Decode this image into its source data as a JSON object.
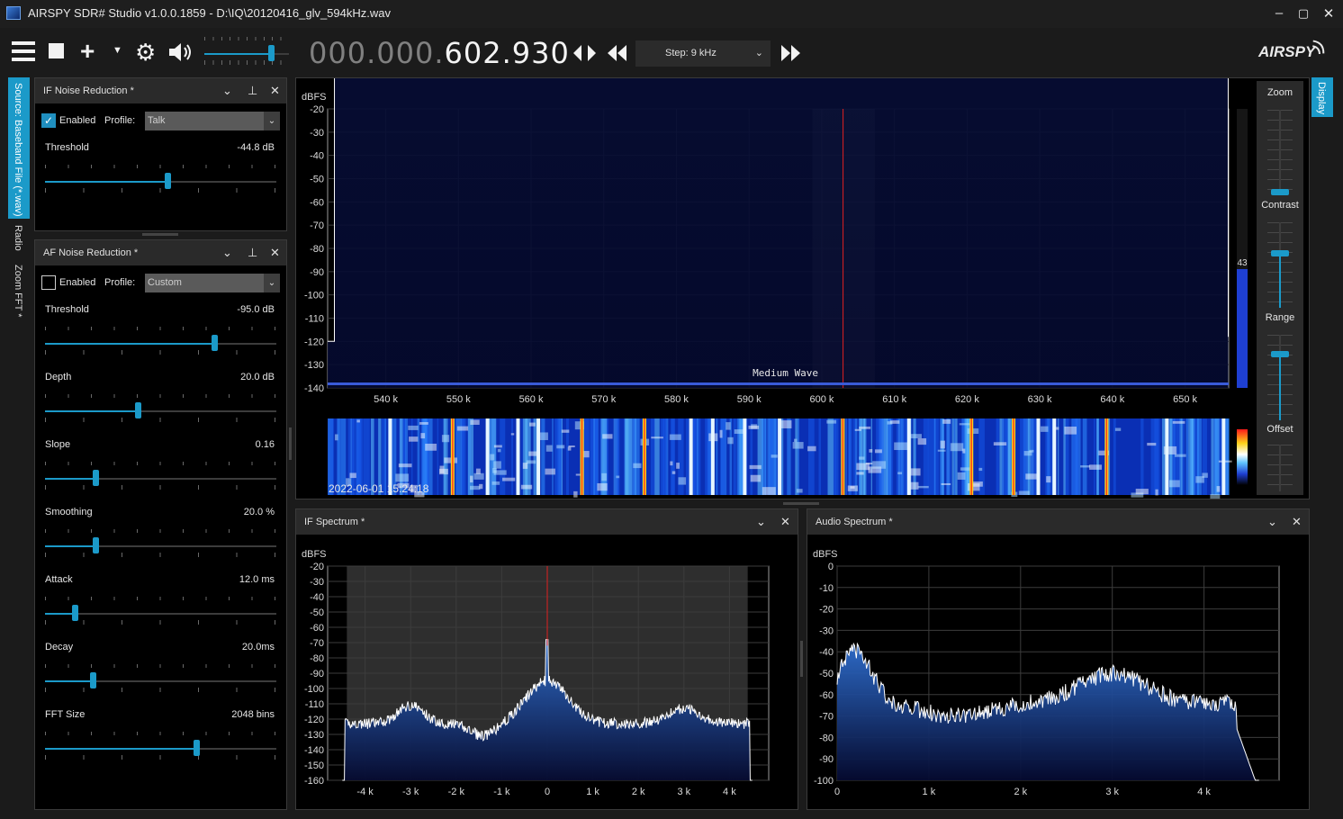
{
  "window": {
    "title": "AIRSPY SDR# Studio v1.0.0.1859 - D:\\IQ\\20120416_glv_594kHz.wav"
  },
  "toolbar": {
    "freq_dim": "000.000.",
    "freq_main": "602.930",
    "step_label": "Step: 9 kHz",
    "logo": "AIRSPY",
    "volume": 0.82
  },
  "left_tabs": [
    "Source: Baseband File (*.wav)",
    "Radio",
    "Zoom FFT *"
  ],
  "right_tabs": [
    "Display"
  ],
  "if_nr": {
    "title": "IF Noise Reduction *",
    "enabled_label": "Enabled",
    "enabled": true,
    "profile_label": "Profile:",
    "profile": "Talk",
    "threshold_label": "Threshold",
    "threshold_value": "-44.8 dB",
    "threshold_level": 0.53
  },
  "af_nr": {
    "title": "AF Noise Reduction *",
    "enabled_label": "Enabled",
    "enabled": false,
    "profile_label": "Profile:",
    "profile": "Custom",
    "params": [
      {
        "label": "Threshold",
        "value": "-95.0 dB",
        "level": 0.74
      },
      {
        "label": "Depth",
        "value": "20.0 dB",
        "level": 0.4
      },
      {
        "label": "Slope",
        "value": "0.16",
        "level": 0.21
      },
      {
        "label": "Smoothing",
        "value": "20.0 %",
        "level": 0.21
      },
      {
        "label": "Attack",
        "value": "12.0 ms",
        "level": 0.12
      },
      {
        "label": "Decay",
        "value": "20.0ms",
        "level": 0.2
      },
      {
        "label": "FFT Size",
        "value": "2048 bins",
        "level": 0.66
      }
    ]
  },
  "display_side": {
    "zoom_label": "Zoom",
    "contrast_label": "Contrast",
    "range_label": "Range",
    "offset_label": "Offset",
    "zoom_level": 0.0,
    "contrast_level": 0.65,
    "range_level": 0.8,
    "level_value": "43"
  },
  "main_spectrum": {
    "ylabel": "dBFS",
    "y_ticks": [
      "-20",
      "-30",
      "-40",
      "-50",
      "-60",
      "-70",
      "-80",
      "-90",
      "-100",
      "-110",
      "-120",
      "-130",
      "-140"
    ],
    "x_ticks": [
      "540 k",
      "550 k",
      "560 k",
      "570 k",
      "580 k",
      "590 k",
      "600 k",
      "610 k",
      "620 k",
      "630 k",
      "640 k",
      "650 k"
    ],
    "band_label": "Medium Wave",
    "waterfall_timestamp": "2022-06-01 15:24:18"
  },
  "if_spectrum": {
    "title": "IF Spectrum *",
    "ylabel": "dBFS",
    "y_ticks": [
      "-20",
      "-30",
      "-40",
      "-50",
      "-60",
      "-70",
      "-80",
      "-90",
      "-100",
      "-110",
      "-120",
      "-130",
      "-140",
      "-150",
      "-160"
    ],
    "x_ticks": [
      "-4 k",
      "-3 k",
      "-2 k",
      "-1 k",
      "0",
      "1 k",
      "2 k",
      "3 k",
      "4 k"
    ]
  },
  "audio_spectrum": {
    "title": "Audio Spectrum *",
    "ylabel": "dBFS",
    "y_ticks": [
      "0",
      "-10",
      "-20",
      "-30",
      "-40",
      "-50",
      "-60",
      "-70",
      "-80",
      "-90",
      "-100"
    ],
    "x_ticks": [
      "0",
      "1 k",
      "2 k",
      "3 k",
      "4 k"
    ]
  },
  "colors": {
    "accent": "#1b9ac9",
    "trace": "#ffffff",
    "fill_top": "#2f6fd0",
    "fill_bottom": "#050a30",
    "tuned": "#e02020"
  }
}
